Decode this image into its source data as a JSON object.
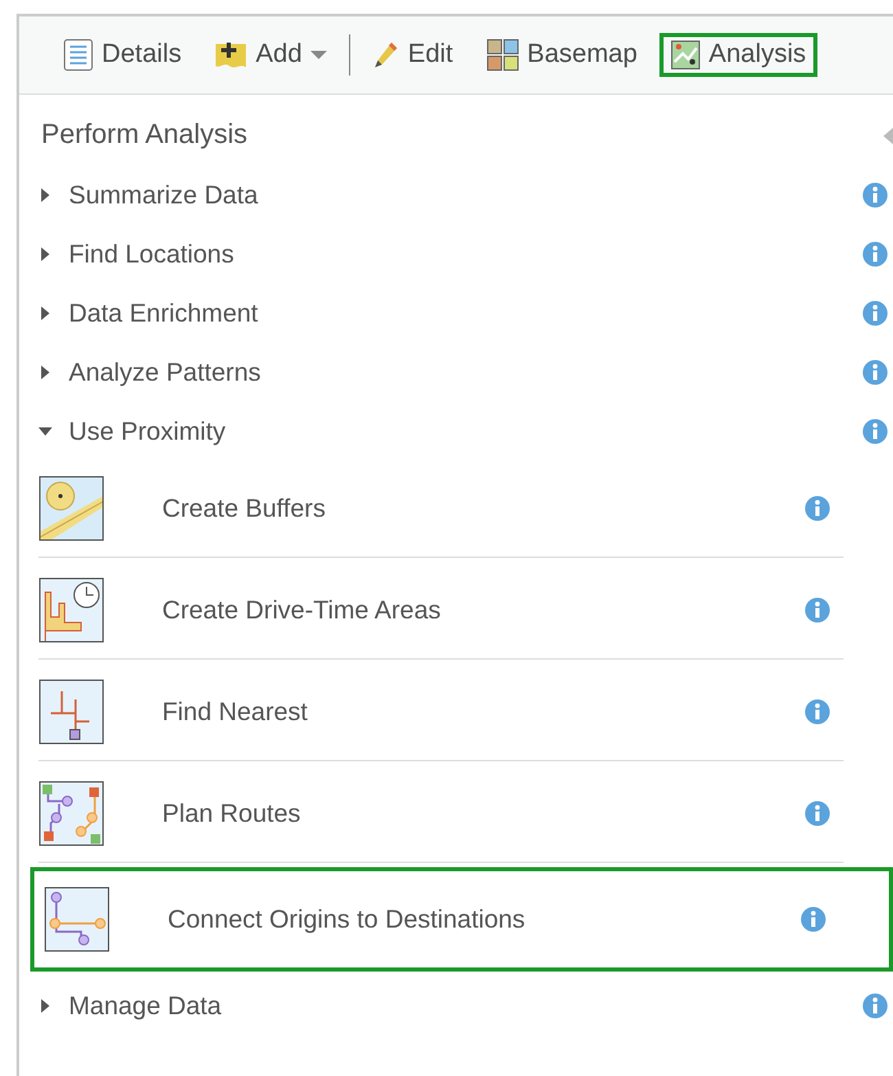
{
  "toolbar": {
    "items": [
      {
        "kind": "button",
        "label": "Details",
        "highlighted": false
      },
      {
        "kind": "dropdown",
        "label": "Add",
        "highlighted": false
      },
      {
        "kind": "separator"
      },
      {
        "kind": "button",
        "label": "Edit",
        "highlighted": false
      },
      {
        "kind": "button",
        "label": "Basemap",
        "highlighted": false
      },
      {
        "kind": "button",
        "label": "Analysis",
        "highlighted": true
      }
    ]
  },
  "panel": {
    "title": "Perform Analysis",
    "categories": [
      {
        "label": "Summarize Data",
        "expanded": false
      },
      {
        "label": "Find Locations",
        "expanded": false
      },
      {
        "label": "Data Enrichment",
        "expanded": false
      },
      {
        "label": "Analyze Patterns",
        "expanded": false
      },
      {
        "label": "Use Proximity",
        "expanded": true,
        "children": [
          {
            "label": "Create Buffers",
            "highlighted": false
          },
          {
            "label": "Create Drive-Time Areas",
            "highlighted": false
          },
          {
            "label": "Find Nearest",
            "highlighted": false
          },
          {
            "label": "Plan Routes",
            "highlighted": false
          },
          {
            "label": "Connect Origins to Destinations",
            "highlighted": true
          }
        ]
      },
      {
        "label": "Manage Data",
        "expanded": false
      }
    ]
  }
}
